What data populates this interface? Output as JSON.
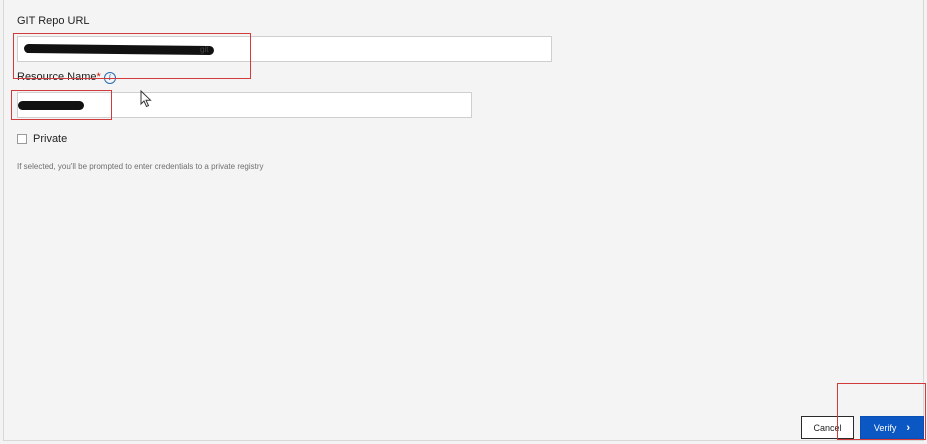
{
  "form": {
    "git_repo_url": {
      "label": "GIT Repo URL",
      "value_suffix": "git"
    },
    "resource_name": {
      "label": "Resource Name",
      "required_mark": "*",
      "info_icon": "info-icon"
    },
    "private": {
      "label": "Private",
      "checked": false,
      "helper_text": "If selected, you'll be prompted to enter credentials to a private registry"
    }
  },
  "actions": {
    "cancel_label": "Cancel",
    "verify_label": "Verify",
    "verify_icon": "chevron-right-icon"
  },
  "colors": {
    "primary": "#0b57c4",
    "highlight": "#d23b3b",
    "background": "#f4f4f4"
  }
}
